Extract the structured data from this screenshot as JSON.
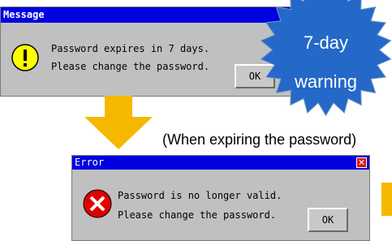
{
  "message_dialog": {
    "title": "Message",
    "icon": "warning-icon",
    "line1": "Password expires in 7 days.",
    "line2": "Please change the password.",
    "ok_label": "OK"
  },
  "badge": {
    "line1": "7-day",
    "line2": "warning",
    "color": "#2468c8"
  },
  "annotation": "(When expiring the password)",
  "error_dialog": {
    "title": "Error",
    "icon": "error-icon",
    "line1": "Password is no longer valid.",
    "line2": "Please change the password.",
    "ok_label": "OK"
  },
  "colors": {
    "titlebar": "#0000e0",
    "dialog_bg": "#c0c0c0",
    "arrow": "#f5b800",
    "warning_icon": "#ffff00",
    "error_icon": "#e00000"
  }
}
